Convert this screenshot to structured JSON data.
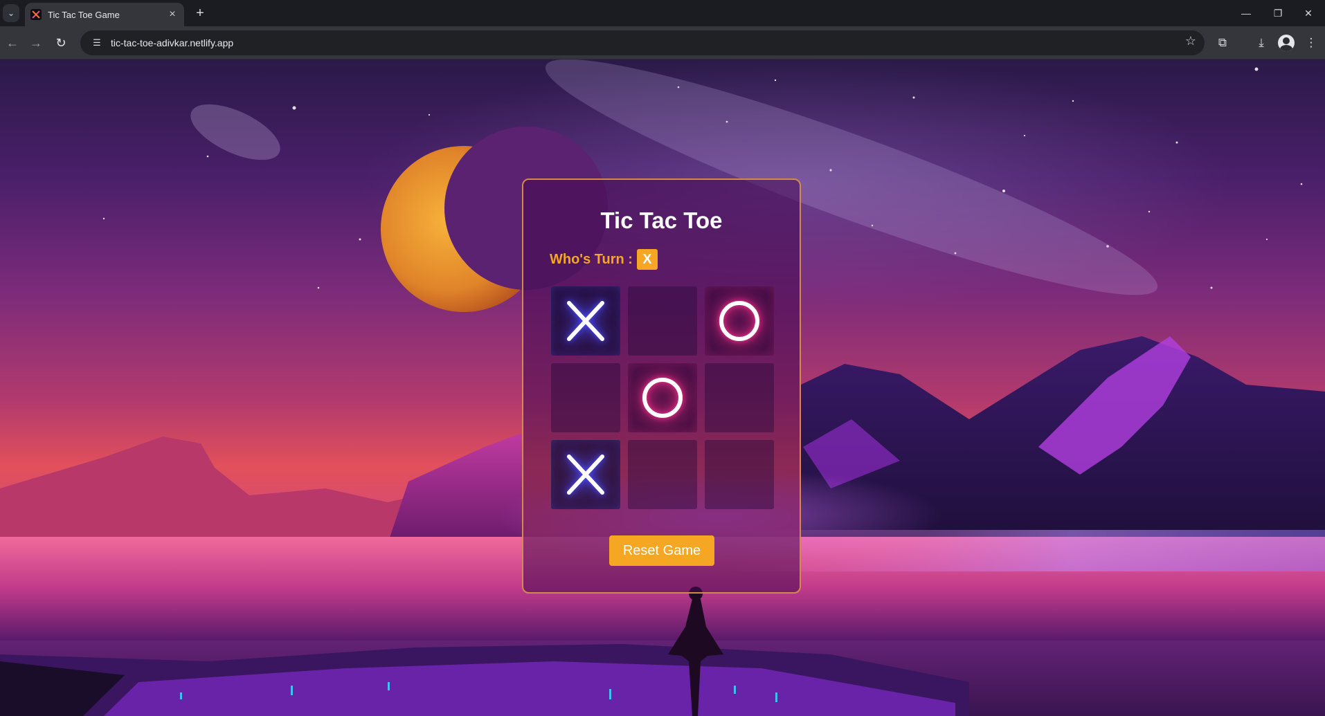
{
  "browser": {
    "tab_title": "Tic Tac Toe Game",
    "url": "tic-tac-toe-adivkar.netlify.app",
    "icons": {
      "tab_menu": "chevron-down-icon",
      "tab_close": "close-icon",
      "new_tab": "plus-icon",
      "back": "back-arrow-icon",
      "forward": "forward-arrow-icon",
      "reload": "reload-icon",
      "site_info": "site-info-icon",
      "bookmark": "star-icon",
      "extensions": "extensions-icon",
      "downloads": "download-icon",
      "profile": "avatar-icon",
      "menu": "kebab-menu-icon",
      "minimize": "minimize-icon",
      "restore": "restore-icon",
      "close_window": "close-icon"
    }
  },
  "game": {
    "title": "Tic Tac Toe",
    "turn_label": "Who's Turn :",
    "current_turn": "X",
    "board": [
      "X",
      "",
      "O",
      "",
      "O",
      "",
      "X",
      "",
      ""
    ],
    "reset_label": "Reset Game",
    "colors": {
      "accent": "#f5a623",
      "x_glow": "#4b4bff",
      "o_glow": "#ff2f8a",
      "card_border": "#d38b4c"
    }
  }
}
